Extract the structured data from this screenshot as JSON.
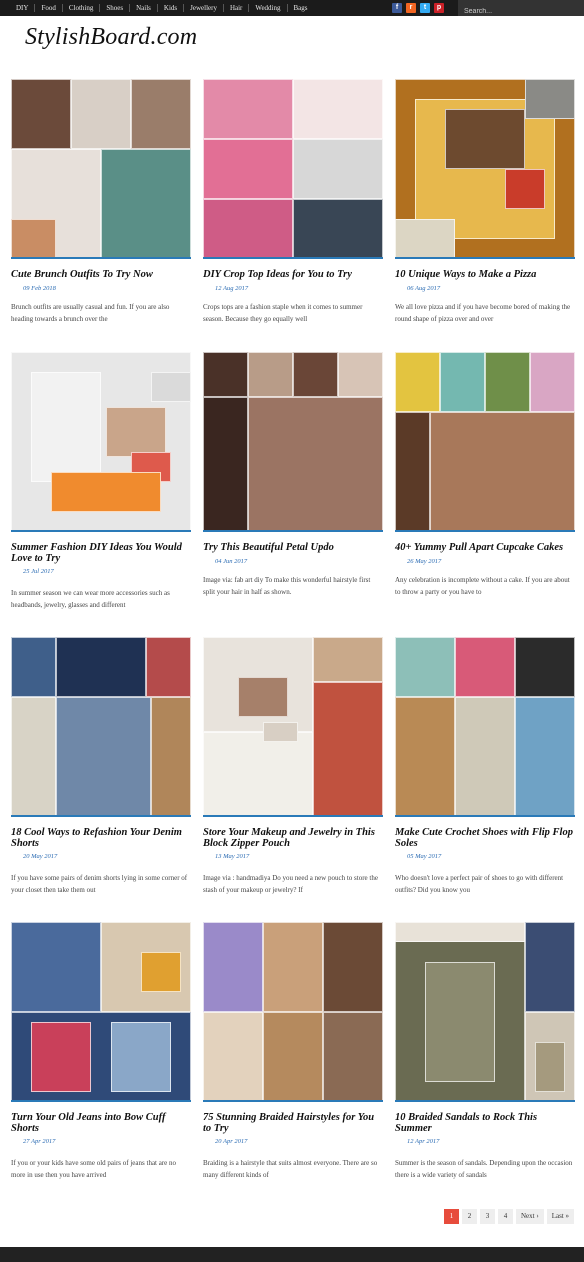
{
  "nav": {
    "items": [
      "DIY",
      "Food",
      "Clothing",
      "Shoes",
      "Nails",
      "Kids",
      "Jewellery",
      "Hair",
      "Wedding",
      "Bags"
    ]
  },
  "social": [
    {
      "name": "facebook-icon",
      "glyph": "f",
      "color": "#3b5998"
    },
    {
      "name": "rss-icon",
      "glyph": "r",
      "color": "#f26522"
    },
    {
      "name": "twitter-icon",
      "glyph": "t",
      "color": "#33aaf2"
    },
    {
      "name": "pinterest-icon",
      "glyph": "p",
      "color": "#cb2027"
    }
  ],
  "search": {
    "placeholder": "Search..."
  },
  "logo": {
    "text": "StylishBoard.com"
  },
  "posts": [
    {
      "title": "Cute Brunch Outfits To Try Now",
      "date": "09 Feb 2018",
      "excerpt": "Brunch outfits are usually casual and fun. If you are also heading towards a brunch over the",
      "palette": [
        "#6b4a3a",
        "#d8cfc6",
        "#9a7d6a",
        "#e7e0da",
        "#5a8f87",
        "#c98d64"
      ]
    },
    {
      "title": "DIY Crop Top Ideas for You to Try",
      "date": "12 Aug 2017",
      "excerpt": "Crops tops are a fashion staple when it comes to summer season. Because they go equally well",
      "palette": [
        "#e38aa8",
        "#f3e5e5",
        "#e26f95",
        "#d7d7d7",
        "#cf5c86",
        "#394655"
      ]
    },
    {
      "title": "10 Unique Ways to Make a Pizza",
      "date": "06 Aug 2017",
      "excerpt": "We all love pizza and if you have become bored of making the round shape of pizza over and over",
      "palette": [
        "#b1701f",
        "#e7b84d",
        "#6d4a2f",
        "#c93c2a",
        "#dcd6c4",
        "#8a8a86"
      ]
    },
    {
      "title": "Summer Fashion DIY Ideas You Would Love to Try",
      "date": "25 Jul 2017",
      "excerpt": "In summer season we can wear more accessories such as headbands, jewelry, glasses and different",
      "palette": [
        "#e7e7e7",
        "#f2f2f2",
        "#c9a58a",
        "#de5a4c",
        "#f08b2e",
        "#dadada"
      ]
    },
    {
      "title": "Try This Beautiful Petal Updo",
      "date": "04 Jun 2017",
      "excerpt": "Image via: fab art diy To make this wonderful hairstyle first split your hair in half as shown.",
      "palette": [
        "#4a3128",
        "#b89c88",
        "#6a4637",
        "#d7c4b6",
        "#3a2620",
        "#9b7463"
      ]
    },
    {
      "title": "40+ Yummy Pull Apart Cupcake Cakes",
      "date": "26 May 2017",
      "excerpt": "Any celebration is incomplete without a cake. If you are about to throw a party or you have to",
      "palette": [
        "#e3c440",
        "#74b8b0",
        "#6f8f49",
        "#d9a6c4",
        "#5b3a27",
        "#a8785a"
      ]
    },
    {
      "title": "18 Cool Ways to Refashion Your Denim Shorts",
      "date": "20 May 2017",
      "excerpt": "If you have some pairs of denim shorts lying in some corner of your closet then take them out",
      "palette": [
        "#3f5f8a",
        "#1f3153",
        "#b44b4b",
        "#d8d3c6",
        "#6f88a8",
        "#b0865a"
      ]
    },
    {
      "title": "Store Your Makeup and Jewelry in This Block Zipper Pouch",
      "date": "13 May 2017",
      "excerpt": "Image via : handmadiya Do you need a new pouch to store the stash of your makeup or jewelry? If",
      "palette": [
        "#e8e3dc",
        "#c9a98a",
        "#c0523f",
        "#f1efe9",
        "#a6806a",
        "#d8cfc4"
      ]
    },
    {
      "title": "Make Cute Crochet Shoes with Flip Flop Soles",
      "date": "05 May 2017",
      "excerpt": "Who doesn't love a perfect pair of shoes to go with different outfits? Did you know you",
      "palette": [
        "#8dbfb8",
        "#d85a78",
        "#2b2b2b",
        "#b98a55",
        "#cfc9b8",
        "#6fa2c5"
      ]
    },
    {
      "title": "Turn Your Old Jeans into Bow Cuff Shorts",
      "date": "27 Apr 2017",
      "excerpt": "If you or your kids have some old pairs of jeans that are no more in use then you have arrived",
      "palette": [
        "#4a6a9c",
        "#d8c8b0",
        "#2f4a78",
        "#c9405a",
        "#8aa7c8",
        "#e0a030"
      ]
    },
    {
      "title": "75 Stunning Braided Hairstyles for You to Try",
      "date": "20 Apr 2017",
      "excerpt": "Braiding is a hairstyle that suits almost everyone. There are so many different kinds of",
      "palette": [
        "#9a8ac9",
        "#c9a07a",
        "#6b4a36",
        "#e3d2bd",
        "#b58a5e",
        "#8a6a54"
      ]
    },
    {
      "title": "10 Braided Sandals to Rock This Summer",
      "date": "12 Apr 2017",
      "excerpt": "Summer is the season of sandals. Depending upon the occasion there is a wide variety of sandals",
      "palette": [
        "#6a6b52",
        "#3b4d73",
        "#cfc6b6",
        "#8b8a6f",
        "#e8e2d8",
        "#a59a7e"
      ]
    }
  ],
  "pagination": {
    "pages": [
      "1",
      "2",
      "3",
      "4"
    ],
    "next": "Next ›",
    "last": "Last »",
    "active": "1"
  }
}
